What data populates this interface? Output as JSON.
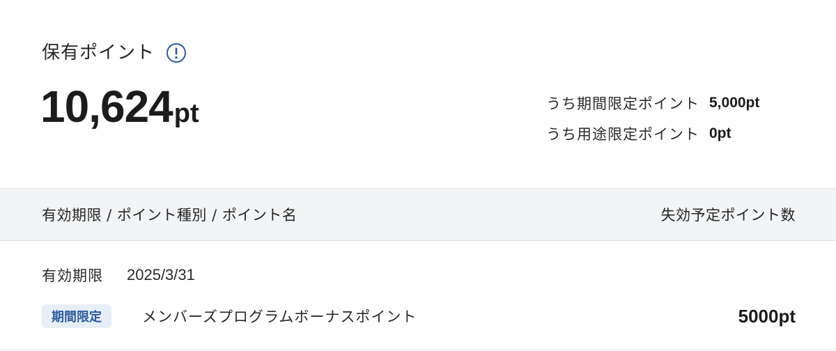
{
  "summary": {
    "title": "保有ポイント",
    "info_icon": "info-circle-icon",
    "total_value": "10,624",
    "total_unit": "pt",
    "breakdown": [
      {
        "label": "うち期間限定ポイント",
        "value": "5,000pt"
      },
      {
        "label": "うち用途限定ポイント",
        "value": "0pt"
      }
    ]
  },
  "table": {
    "header_left": "有効期限 / ポイント種別 / ポイント名",
    "header_right": "失効予定ポイント数",
    "rows": [
      {
        "expiry_label": "有効期限",
        "expiry_date": "2025/3/31",
        "badge": "期間限定",
        "name": "メンバーズプログラムボーナスポイント",
        "amount": "5000pt"
      }
    ]
  },
  "colors": {
    "accent": "#2c5aa0",
    "badge_bg": "#e8eef7",
    "header_bg": "#f3f4f6"
  }
}
